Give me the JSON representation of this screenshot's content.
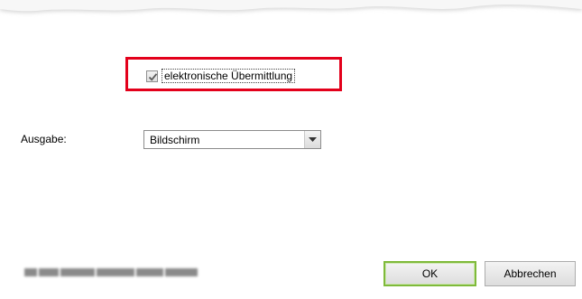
{
  "options": {
    "electronic_transmission": {
      "label": "elektronische Übermittlung",
      "checked": true
    }
  },
  "output": {
    "label": "Ausgabe:",
    "selected": "Bildschirm"
  },
  "footer": {
    "ok_label": "OK",
    "cancel_label": "Abbrechen"
  },
  "colors": {
    "highlight": "#e3001b",
    "ok_border": "#7fba3a"
  }
}
